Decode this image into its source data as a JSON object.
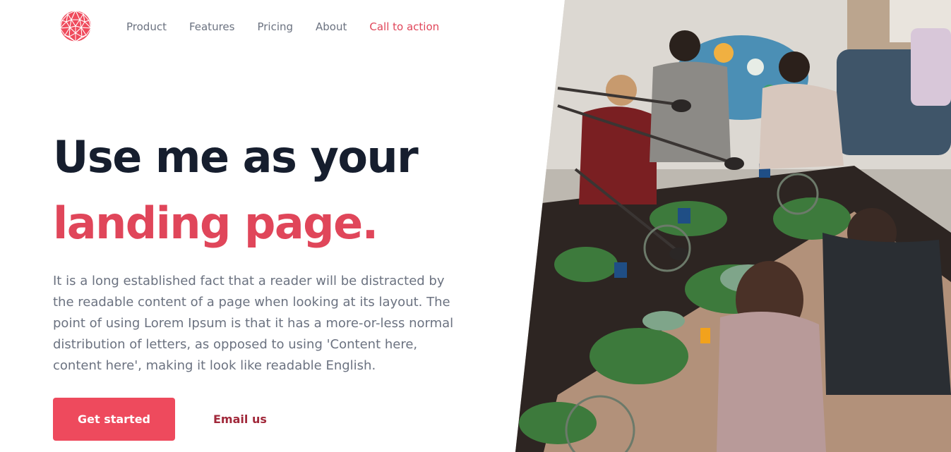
{
  "brand": {
    "logo_icon": "geometric-sphere-logo-icon",
    "accent_color": "#e0465a"
  },
  "nav": {
    "items": [
      {
        "label": "Product"
      },
      {
        "label": "Features"
      },
      {
        "label": "Pricing"
      },
      {
        "label": "About"
      }
    ],
    "cta_label": "Call to action"
  },
  "hero": {
    "title_line1": "Use me as your",
    "title_line2": "landing page.",
    "body": "It is a long established fact that a reader will be distracted by the readable content of a page when looking at its layout. The point of using Lorem Ipsum is that it has a more-or-less normal distribution of letters, as opposed to using 'Content here, content here', making it look like readable English.",
    "primary_button": "Get started",
    "secondary_button": "Email us"
  },
  "image": {
    "icon": "team-workshop-photo"
  }
}
